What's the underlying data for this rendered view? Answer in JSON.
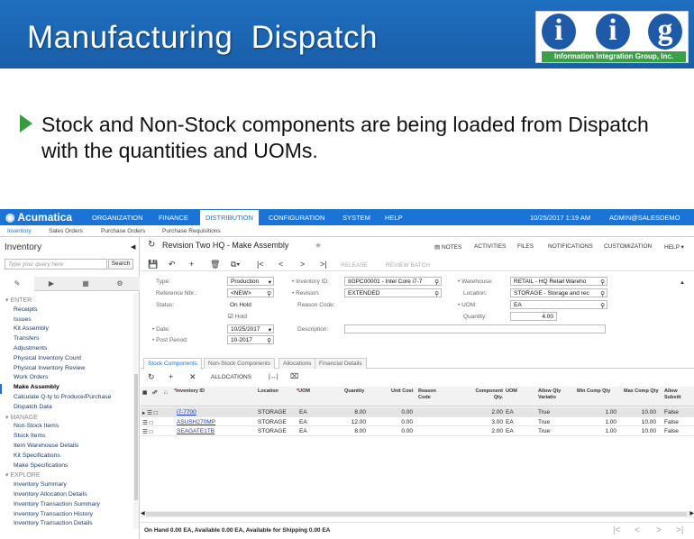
{
  "slide": {
    "title": "Manufacturing  Dispatch",
    "bullet": "Stock and Non-Stock components are being loaded from Dispatch with the quantities and UOMs.",
    "logo": {
      "letters": [
        "i",
        "i",
        "g"
      ],
      "company": "Information Integration Group, Inc."
    }
  },
  "app": {
    "brand": "Acumatica",
    "nav": [
      "ORGANIZATION",
      "FINANCE",
      "DISTRIBUTION",
      "CONFIGURATION",
      "SYSTEM",
      "HELP"
    ],
    "active_nav": "DISTRIBUTION",
    "datetime": "10/25/2017  1:19 AM",
    "user": "ADMIN@SALESDEMO",
    "subnav": [
      "Inventory",
      "Sales Orders",
      "Purchase Orders",
      "Purchase Requisitions"
    ]
  },
  "sidebar": {
    "title": "Inventory",
    "search_placeholder": "Type your query here",
    "search_button": "Search",
    "sections": [
      {
        "name": "ENTER",
        "items": [
          "Receipts",
          "Issues",
          "Kit Assembly",
          "Transfers",
          "Adjustments",
          "Physical Inventory Count",
          "Physical Inventory Review",
          "Work Orders",
          "Make Assembly",
          "Calculate Q-ty to Produce/Purchase",
          "Dispatch Data"
        ]
      },
      {
        "name": "MANAGE",
        "items": [
          "Non-Stock Items",
          "Stock Items",
          "Item Warehouse Details",
          "Kit Specifications",
          "Make Specifications"
        ]
      },
      {
        "name": "EXPLORE",
        "items": [
          "Inventory Summary",
          "Inventory Allocation Details",
          "Inventory Transaction Summary",
          "Inventory Transaction History",
          "Inventory Transaction Details"
        ]
      }
    ],
    "selected_item": "Make Assembly"
  },
  "page": {
    "title": "Revision Two HQ  -  Make Assembly",
    "top_links": [
      "NOTES",
      "ACTIVITIES",
      "FILES",
      "NOTIFICATIONS",
      "CUSTOMIZATION",
      "HELP"
    ],
    "toolbar_disabled": [
      "RELEASE",
      "REVIEW BATCH"
    ]
  },
  "form": {
    "type_label": "Type:",
    "type_value": "Production",
    "ref_label": "Reference Nbr.:",
    "ref_value": "<NEW>",
    "status_label": "Status:",
    "status_value": "On Hold",
    "hold_label": "Hold",
    "date_label": "Date:",
    "date_value": "10/25/2017",
    "period_label": "Post Period:",
    "period_value": "10-2017",
    "inv_label": "Inventory ID:",
    "inv_value": "IIGPC00001 - Intel Core i7-7",
    "rev_label": "Revision:",
    "rev_value": "EXTENDED",
    "reason_label": "Reason Code:",
    "desc_label": "Description:",
    "wh_label": "Warehouse:",
    "wh_value": "RETAIL - HQ Retail Wareho",
    "loc_label": "Location:",
    "loc_value": "STORAGE - Storage and rec",
    "uom_label": "UOM:",
    "uom_value": "EA",
    "qty_label": "Quantity:",
    "qty_value": "4.00"
  },
  "grid": {
    "tabs": [
      "Stock Components",
      "Non-Stock Components",
      "Allocations",
      "Financial Details"
    ],
    "allocations_label": "ALLOCATIONS",
    "headers": [
      "Inventory ID",
      "Location",
      "UOM",
      "Quantity",
      "Unit Cost",
      "Reason Code",
      "Component Qty.",
      "UOM",
      "Allow Qty Variatio",
      "Min Comp Qty",
      "Max Comp Qty",
      "Allow Substit"
    ],
    "rows": [
      [
        "i7-7700",
        "STORAGE",
        "EA",
        "8.00",
        "0.00",
        "",
        "2.00",
        "EA",
        "True",
        "1.00",
        "10.00",
        "False"
      ],
      [
        "ASUSH270MP",
        "STORAGE",
        "EA",
        "12.00",
        "0.00",
        "",
        "3.00",
        "EA",
        "True",
        "1.00",
        "10.00",
        "False"
      ],
      [
        "SEAGATE1TB",
        "STORAGE",
        "EA",
        "8.00",
        "0.00",
        "",
        "2.00",
        "EA",
        "True",
        "1.00",
        "10.00",
        "False"
      ]
    ]
  },
  "status_bar": "On Hand 0.00 EA, Available 0.00 EA, Available for Shipping 0.00 EA"
}
